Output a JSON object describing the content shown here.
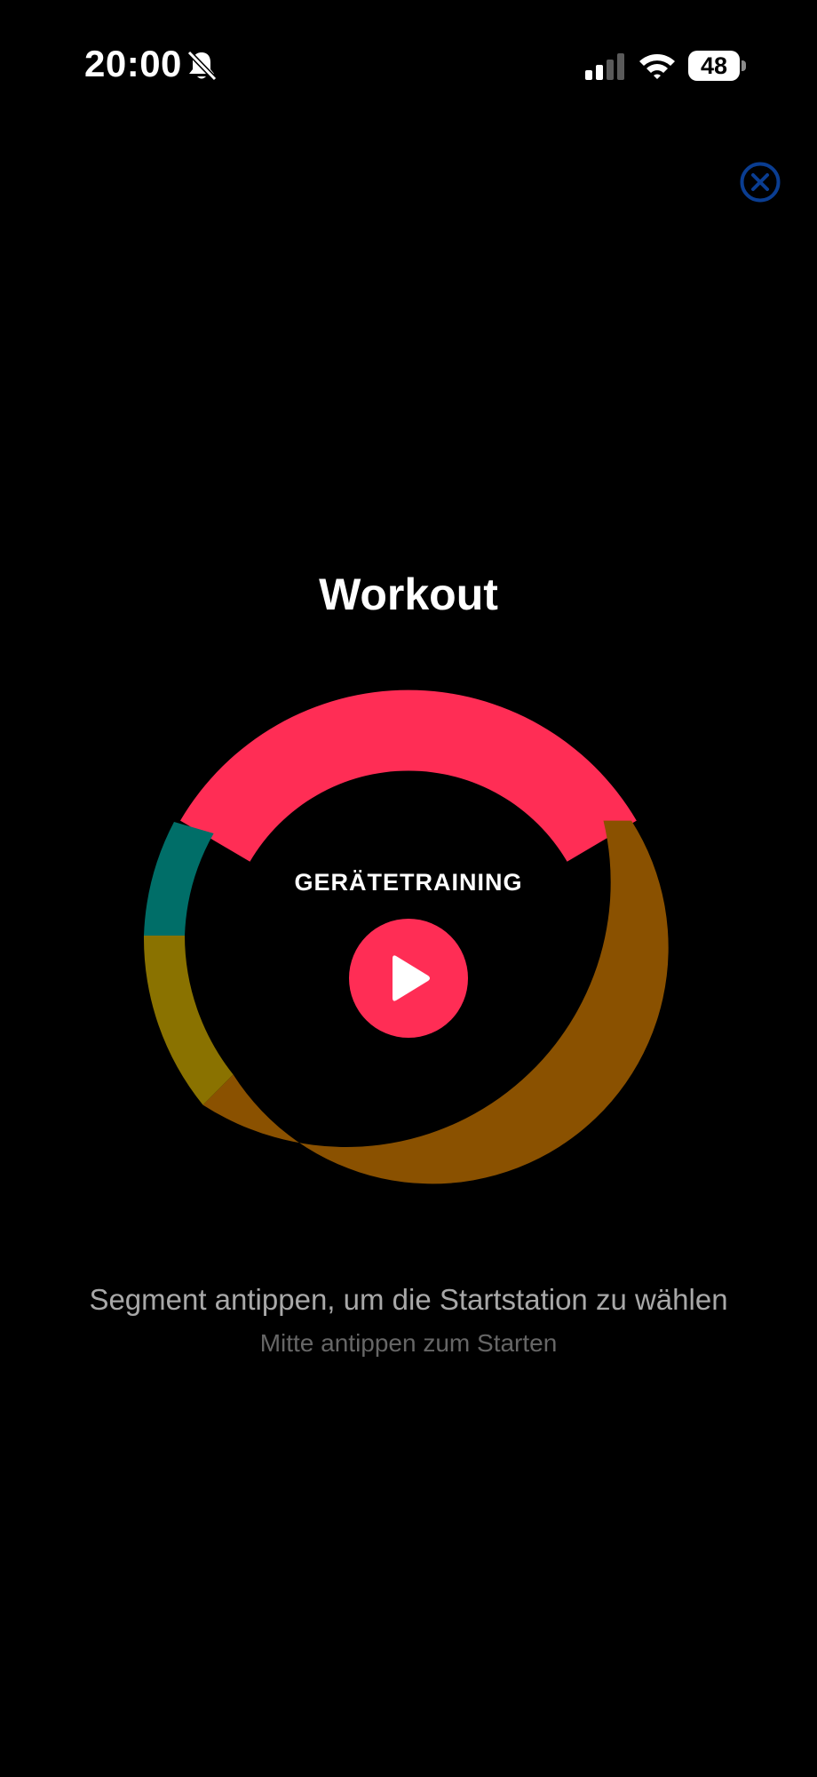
{
  "status_bar": {
    "time": "20:00",
    "battery_level": "48",
    "icons": [
      "bell-slash-icon",
      "cellular-signal-icon",
      "wifi-icon",
      "battery-icon"
    ]
  },
  "close_button": {
    "icon": "close-circle-icon",
    "color": "#0a3d91"
  },
  "main": {
    "title": "Workout",
    "station_label": "GERÄTETRAINING",
    "play_button": {
      "icon": "play-icon",
      "color": "#ff2d55"
    },
    "segments": [
      {
        "name": "segment-selected",
        "color": "#ff2d55",
        "selected": true
      },
      {
        "name": "segment-right",
        "color": "#8a5100",
        "selected": false
      },
      {
        "name": "segment-olive",
        "color": "#8a7200",
        "selected": false
      },
      {
        "name": "segment-teal",
        "color": "#006e68",
        "selected": false
      }
    ],
    "hint_primary": "Segment antippen, um die Startstation zu wählen",
    "hint_secondary": "Mitte antippen zum Starten"
  }
}
